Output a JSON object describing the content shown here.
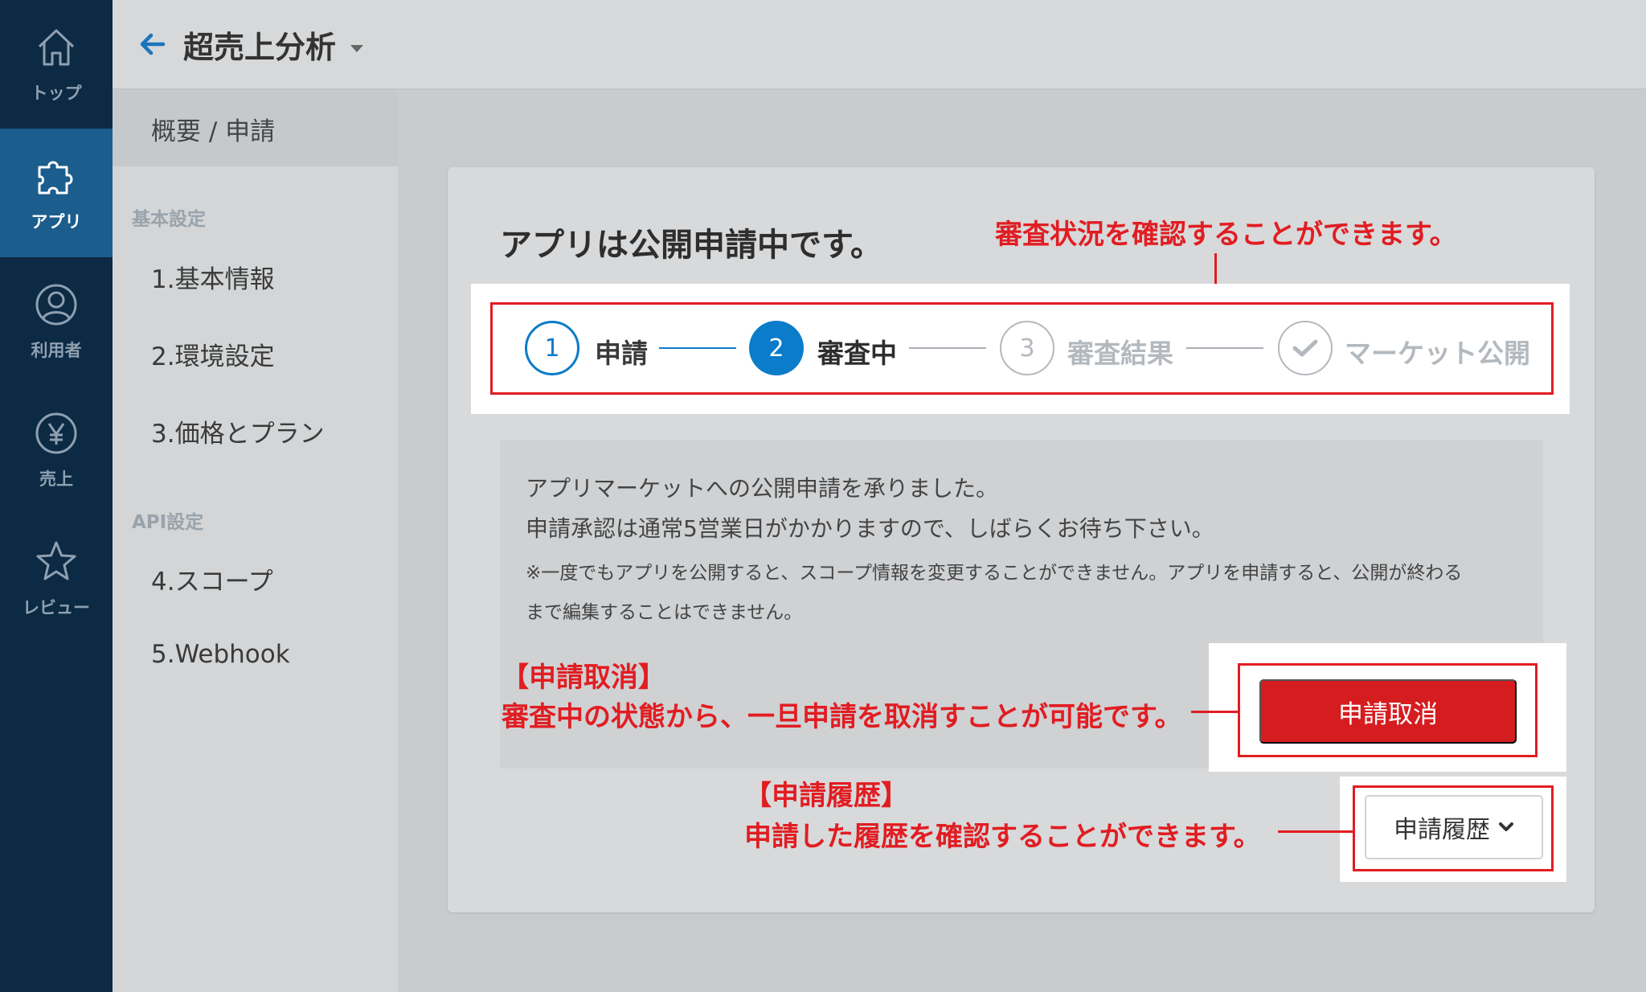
{
  "rail": {
    "items": [
      {
        "label": "トップ",
        "icon": "home-icon"
      },
      {
        "label": "アプリ",
        "icon": "puzzle-icon"
      },
      {
        "label": "利用者",
        "icon": "user-icon"
      },
      {
        "label": "売上",
        "icon": "yen-icon"
      },
      {
        "label": "レビュー",
        "icon": "star-icon"
      }
    ],
    "active_index": 1
  },
  "header": {
    "title": "超売上分析"
  },
  "subnav": {
    "top_item": "概要 / 申請",
    "section_basic": "基本設定",
    "basic_items": [
      "1.基本情報",
      "2.環境設定",
      "3.価格とプラン"
    ],
    "section_api": "API設定",
    "api_items": [
      "4.スコープ",
      "5.Webhook"
    ]
  },
  "main": {
    "title": "アプリは公開申請中です。",
    "steps": [
      {
        "number": "1",
        "label": "申請",
        "state": "done"
      },
      {
        "number": "2",
        "label": "審査中",
        "state": "current"
      },
      {
        "number": "3",
        "label": "審査結果",
        "state": "pending"
      },
      {
        "number": "",
        "label": "マーケット公開",
        "state": "pending",
        "icon": "check-icon"
      }
    ],
    "message": {
      "line1": "アプリマーケットへの公開申請を承りました。",
      "line2": "申請承認は通常5営業日がかかりますので、しばらくお待ち下さい。",
      "note1": "※一度でもアプリを公開すると、スコープ情報を変更することができません。アプリを申請すると、公開が終わる",
      "note2": "まで編集することはできません。"
    },
    "cancel_button": "申請取消",
    "history_button": "申請履歴"
  },
  "annotations": {
    "status": "審査状況を確認することができます。",
    "cancel_title": "【申請取消】",
    "cancel_desc": "審査中の状態から、一旦申請を取消すことが可能です。",
    "history_title": "【申請履歴】",
    "history_desc": "申請した履歴を確認することができます。"
  },
  "colors": {
    "rail_bg": "#0c2a44",
    "rail_active": "#1b5d8c",
    "accent_blue": "#0a7cc9",
    "annotation_red": "#e11d22",
    "cancel_red": "#d51d20"
  }
}
